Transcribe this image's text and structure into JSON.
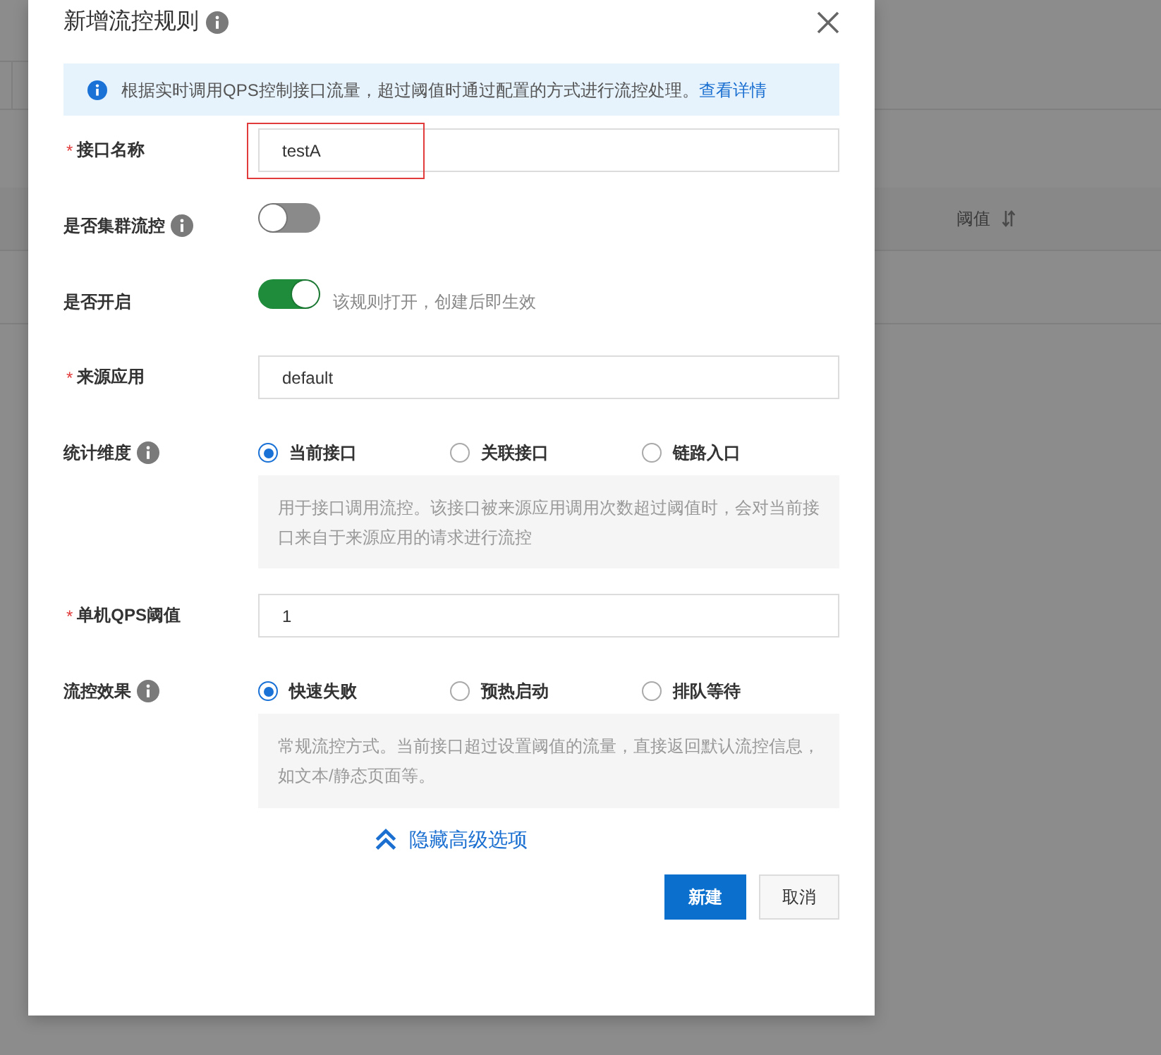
{
  "background_table": {
    "column_header": "阈值"
  },
  "dialog": {
    "title": "新增流控规则",
    "notice": {
      "text": "根据实时调用QPS控制接口流量，超过阈值时通过配置的方式进行流控处理。",
      "link": "查看详情"
    },
    "fields": [
      {
        "kind": "input",
        "required_mark": "*",
        "label": "接口名称",
        "value": "testA",
        "highlighted": true
      },
      {
        "kind": "switch",
        "label": "是否集群流控",
        "has_info": true,
        "on": false
      },
      {
        "kind": "switch",
        "label": "是否开启",
        "on": true,
        "hint": "该规则打开，创建后即生效"
      },
      {
        "kind": "input",
        "required_mark": "*",
        "label": "来源应用",
        "value": "default"
      },
      {
        "kind": "radio",
        "label": "统计维度",
        "has_info": true,
        "options": [
          {
            "label": "当前接口",
            "selected": true
          },
          {
            "label": "关联接口",
            "selected": false
          },
          {
            "label": "链路入口",
            "selected": false
          }
        ],
        "description": "用于接口调用流控。该接口被来源应用调用次数超过阈值时，会对当前接口来自于来源应用的请求进行流控"
      },
      {
        "kind": "input",
        "required_mark": "*",
        "label": "单机QPS阈值",
        "value": "1"
      },
      {
        "kind": "radio",
        "label": "流控效果",
        "has_info": true,
        "options": [
          {
            "label": "快速失败",
            "selected": true
          },
          {
            "label": "预热启动",
            "selected": false
          },
          {
            "label": "排队等待",
            "selected": false
          }
        ],
        "description": "常规流控方式。当前接口超过设置阈值的流量，直接返回默认流控信息，如文本/静态页面等。"
      }
    ],
    "advanced_toggle": {
      "label": "隐藏高级选项",
      "expanded": true
    },
    "buttons": [
      {
        "label": "新建",
        "primary": true
      },
      {
        "label": "取消",
        "primary": false
      }
    ]
  }
}
